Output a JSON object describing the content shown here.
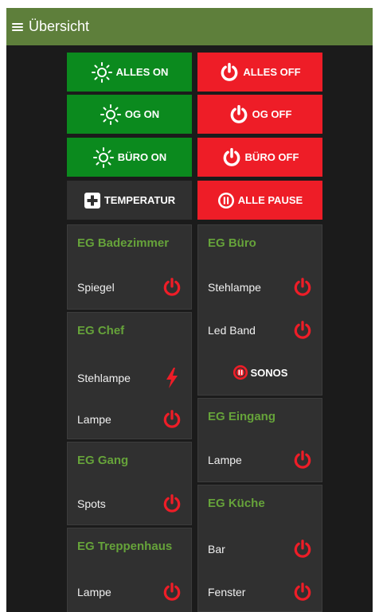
{
  "header": {
    "title": "Übersicht",
    "menu_icon": "hamburger-menu-icon",
    "color": "#5e7f3b"
  },
  "colors": {
    "green": "#0b8a1e",
    "red": "#ee1d27",
    "accent_text": "#66a33a",
    "card": "#303030",
    "background": "#1b1b1b"
  },
  "buttons": {
    "alles_on": "ALLES ON",
    "alles_off": "ALLES OFF",
    "og_on": "OG ON",
    "og_off": "OG OFF",
    "buero_on": "BÜRO ON",
    "buero_off": "BÜRO OFF",
    "temperatur": "TEMPERATUR",
    "alle_pause": "ALLE PAUSE"
  },
  "rooms": {
    "badezimmer": {
      "title": "EG Badezimmer",
      "items": [
        {
          "label": "Spiegel",
          "icon": "power-icon"
        }
      ]
    },
    "chef": {
      "title": "EG Chef",
      "items": [
        {
          "label": "Stehlampe",
          "icon": "lightning-icon"
        },
        {
          "label": "Lampe",
          "icon": "power-icon"
        }
      ]
    },
    "gang": {
      "title": "EG Gang",
      "items": [
        {
          "label": "Spots",
          "icon": "power-icon"
        }
      ]
    },
    "treppenhaus": {
      "title": "EG Treppenhaus",
      "items": [
        {
          "label": "Lampe",
          "icon": "power-icon"
        }
      ]
    },
    "buero": {
      "title": "EG Büro",
      "items": [
        {
          "label": "Stehlampe",
          "icon": "power-icon"
        },
        {
          "label": "Led Band",
          "icon": "power-icon"
        }
      ],
      "sonos_label": "SONOS"
    },
    "eingang": {
      "title": "EG Eingang",
      "items": [
        {
          "label": "Lampe",
          "icon": "power-icon"
        }
      ]
    },
    "kueche": {
      "title": "EG Küche",
      "items": [
        {
          "label": "Bar",
          "icon": "power-icon"
        },
        {
          "label": "Fenster",
          "icon": "power-icon"
        }
      ]
    }
  }
}
